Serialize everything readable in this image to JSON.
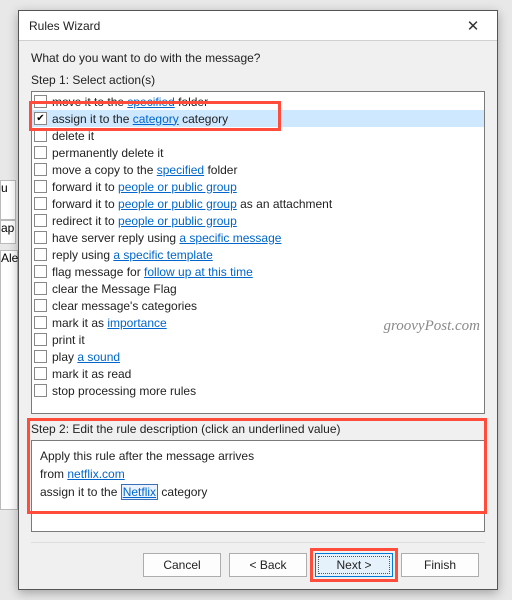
{
  "bg": {
    "tab1": "u",
    "tab2": "ap",
    "tab3": "Ale"
  },
  "dialog": {
    "title": "Rules Wizard",
    "prompt": "What do you want to do with the message?",
    "step1_label": "Step 1: Select action(s)",
    "step2_label": "Step 2: Edit the rule description (click an underlined value)",
    "actions": [
      {
        "checked": false,
        "selected": false,
        "parts": [
          {
            "t": "move it to the "
          },
          {
            "t": "specified",
            "link": true
          },
          {
            "t": " folder"
          }
        ]
      },
      {
        "checked": true,
        "selected": true,
        "parts": [
          {
            "t": "assign it to the "
          },
          {
            "t": "category",
            "link": true
          },
          {
            "t": " category"
          }
        ]
      },
      {
        "checked": false,
        "selected": false,
        "parts": [
          {
            "t": "delete it"
          }
        ]
      },
      {
        "checked": false,
        "selected": false,
        "parts": [
          {
            "t": "permanently delete it"
          }
        ]
      },
      {
        "checked": false,
        "selected": false,
        "parts": [
          {
            "t": "move a copy to the "
          },
          {
            "t": "specified",
            "link": true
          },
          {
            "t": " folder"
          }
        ]
      },
      {
        "checked": false,
        "selected": false,
        "parts": [
          {
            "t": "forward it to "
          },
          {
            "t": "people or public group",
            "link": true
          }
        ]
      },
      {
        "checked": false,
        "selected": false,
        "parts": [
          {
            "t": "forward it to "
          },
          {
            "t": "people or public group",
            "link": true
          },
          {
            "t": " as an attachment"
          }
        ]
      },
      {
        "checked": false,
        "selected": false,
        "parts": [
          {
            "t": "redirect it to "
          },
          {
            "t": "people or public group",
            "link": true
          }
        ]
      },
      {
        "checked": false,
        "selected": false,
        "parts": [
          {
            "t": "have server reply using "
          },
          {
            "t": "a specific message",
            "link": true
          }
        ]
      },
      {
        "checked": false,
        "selected": false,
        "parts": [
          {
            "t": "reply using "
          },
          {
            "t": "a specific template",
            "link": true
          }
        ]
      },
      {
        "checked": false,
        "selected": false,
        "parts": [
          {
            "t": "flag message for "
          },
          {
            "t": "follow up at this time",
            "link": true
          }
        ]
      },
      {
        "checked": false,
        "selected": false,
        "parts": [
          {
            "t": "clear the Message Flag"
          }
        ]
      },
      {
        "checked": false,
        "selected": false,
        "parts": [
          {
            "t": "clear message's categories"
          }
        ]
      },
      {
        "checked": false,
        "selected": false,
        "parts": [
          {
            "t": "mark it as "
          },
          {
            "t": "importance",
            "link": true
          }
        ]
      },
      {
        "checked": false,
        "selected": false,
        "parts": [
          {
            "t": "print it"
          }
        ]
      },
      {
        "checked": false,
        "selected": false,
        "parts": [
          {
            "t": "play "
          },
          {
            "t": "a sound",
            "link": true
          }
        ]
      },
      {
        "checked": false,
        "selected": false,
        "parts": [
          {
            "t": "mark it as read"
          }
        ]
      },
      {
        "checked": false,
        "selected": false,
        "parts": [
          {
            "t": "stop processing more rules"
          }
        ]
      }
    ],
    "desc": {
      "line1": "Apply this rule after the message arrives",
      "line2_pre": "from ",
      "line2_link": "netflix.com",
      "line3_pre": "assign it to the ",
      "line3_link": "Netflix",
      "line3_post": " category"
    },
    "buttons": {
      "cancel": "Cancel",
      "back": "< Back",
      "next": "Next >",
      "finish": "Finish"
    }
  },
  "watermark": "groovyPost.com"
}
